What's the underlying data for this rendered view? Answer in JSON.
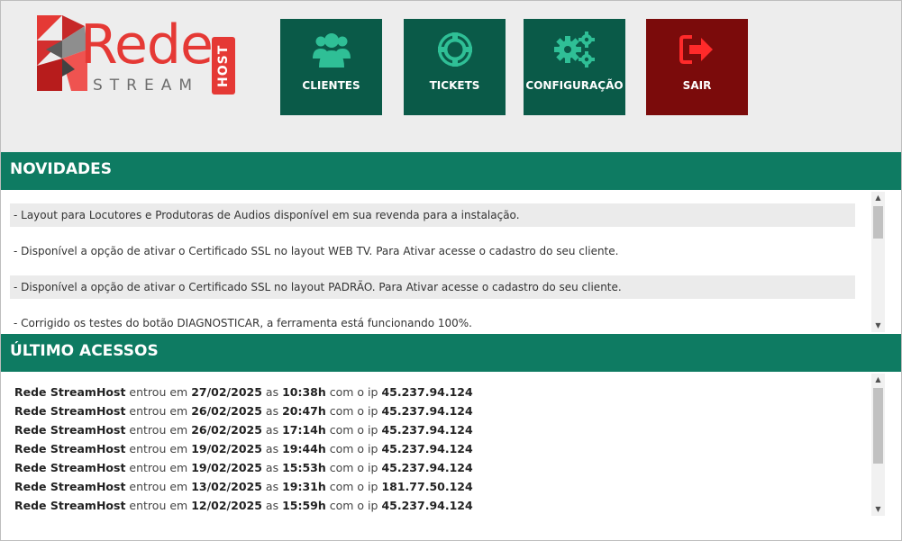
{
  "logo": {
    "word": "Rede",
    "sub": "STREAM",
    "host": "HOST"
  },
  "nav": {
    "clientes": "CLIENTES",
    "tickets": "TICKETS",
    "configuracao": "CONFIGURAÇÃO",
    "sair": "SAIR"
  },
  "colors": {
    "header_bg": "#ededed",
    "nav_green": "#0a5a48",
    "nav_icon": "#2fbf96",
    "nav_red": "#7b0b0b",
    "nav_red_icon": "#ff2a2a",
    "section_green": "#0e7b62",
    "logo_red": "#e53935"
  },
  "news": {
    "title": "NOVIDADES",
    "items": [
      "- Layout para Locutores e Produtoras de Audios disponível em sua revenda para a instalação.",
      "- Disponível a opção de ativar o Certificado SSL no layout WEB TV. Para Ativar acesse o cadastro do seu cliente.",
      "- Disponível a opção de ativar o Certificado SSL no layout PADRÃO. Para Ativar acesse o cadastro do seu cliente.",
      "- Corrigido os testes do botão DIAGNOSTICAR, a ferramenta está funcionando 100%."
    ]
  },
  "access": {
    "title": "ÚLTIMO ACESSOS",
    "rows": [
      {
        "user": "Rede StreamHost",
        "t1": "entrou em",
        "date": "27/02/2025",
        "t2": "as",
        "time": "10:38h",
        "t3": "com o ip",
        "ip": "45.237.94.124"
      },
      {
        "user": "Rede StreamHost",
        "t1": "entrou em",
        "date": "26/02/2025",
        "t2": "as",
        "time": "20:47h",
        "t3": "com o ip",
        "ip": "45.237.94.124"
      },
      {
        "user": "Rede StreamHost",
        "t1": "entrou em",
        "date": "26/02/2025",
        "t2": "as",
        "time": "17:14h",
        "t3": "com o ip",
        "ip": "45.237.94.124"
      },
      {
        "user": "Rede StreamHost",
        "t1": "entrou em",
        "date": "19/02/2025",
        "t2": "as",
        "time": "19:44h",
        "t3": "com o ip",
        "ip": "45.237.94.124"
      },
      {
        "user": "Rede StreamHost",
        "t1": "entrou em",
        "date": "19/02/2025",
        "t2": "as",
        "time": "15:53h",
        "t3": "com o ip",
        "ip": "45.237.94.124"
      },
      {
        "user": "Rede StreamHost",
        "t1": "entrou em",
        "date": "13/02/2025",
        "t2": "as",
        "time": "19:31h",
        "t3": "com o ip",
        "ip": "181.77.50.124"
      },
      {
        "user": "Rede StreamHost",
        "t1": "entrou em",
        "date": "12/02/2025",
        "t2": "as",
        "time": "15:59h",
        "t3": "com o ip",
        "ip": "45.237.94.124"
      }
    ]
  },
  "icons": {
    "clientes": "users-icon",
    "tickets": "lifebuoy-icon",
    "configuracao": "gears-icon",
    "sair": "sign-out-icon",
    "scroll_up": "arrow-up-icon",
    "scroll_down": "arrow-down-icon"
  }
}
